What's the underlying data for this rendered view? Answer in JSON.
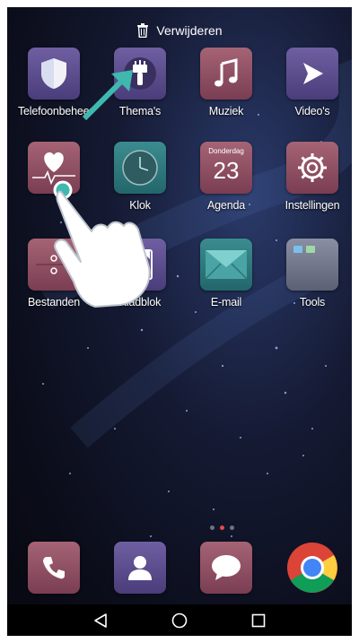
{
  "topbar": {
    "label": "Verwijderen",
    "icon": "trash-icon"
  },
  "apps": [
    {
      "label": "Telefoonbeheer",
      "icon": "shield-icon"
    },
    {
      "label": "Thema's",
      "icon": "paintbrush-icon"
    },
    {
      "label": "Muziek",
      "icon": "music-note-icon"
    },
    {
      "label": "Video's",
      "icon": "play-icon"
    },
    {
      "label": "",
      "icon": "health-heart-icon"
    },
    {
      "label": "Klok",
      "icon": "clock-icon"
    },
    {
      "label": "Agenda",
      "icon": "calendar-icon",
      "weekday": "Donderdag",
      "day": "23"
    },
    {
      "label": "Instellingen",
      "icon": "gear-icon"
    },
    {
      "label": "Bestanden",
      "icon": "files-icon"
    },
    {
      "label": "Kladblok",
      "icon": "notepad-icon"
    },
    {
      "label": "E-mail",
      "icon": "envelope-icon"
    },
    {
      "label": "Tools",
      "icon": "folder-icon"
    }
  ],
  "dock": [
    {
      "icon": "phone-icon"
    },
    {
      "icon": "contacts-icon"
    },
    {
      "icon": "messages-icon"
    },
    {
      "icon": "chrome-icon"
    }
  ],
  "navbar": [
    {
      "icon": "back-icon"
    },
    {
      "icon": "home-icon"
    },
    {
      "icon": "recents-icon"
    }
  ],
  "colors": {
    "accent_teal": "#3fb8b0",
    "page_dot_active": "#e34a4a"
  }
}
